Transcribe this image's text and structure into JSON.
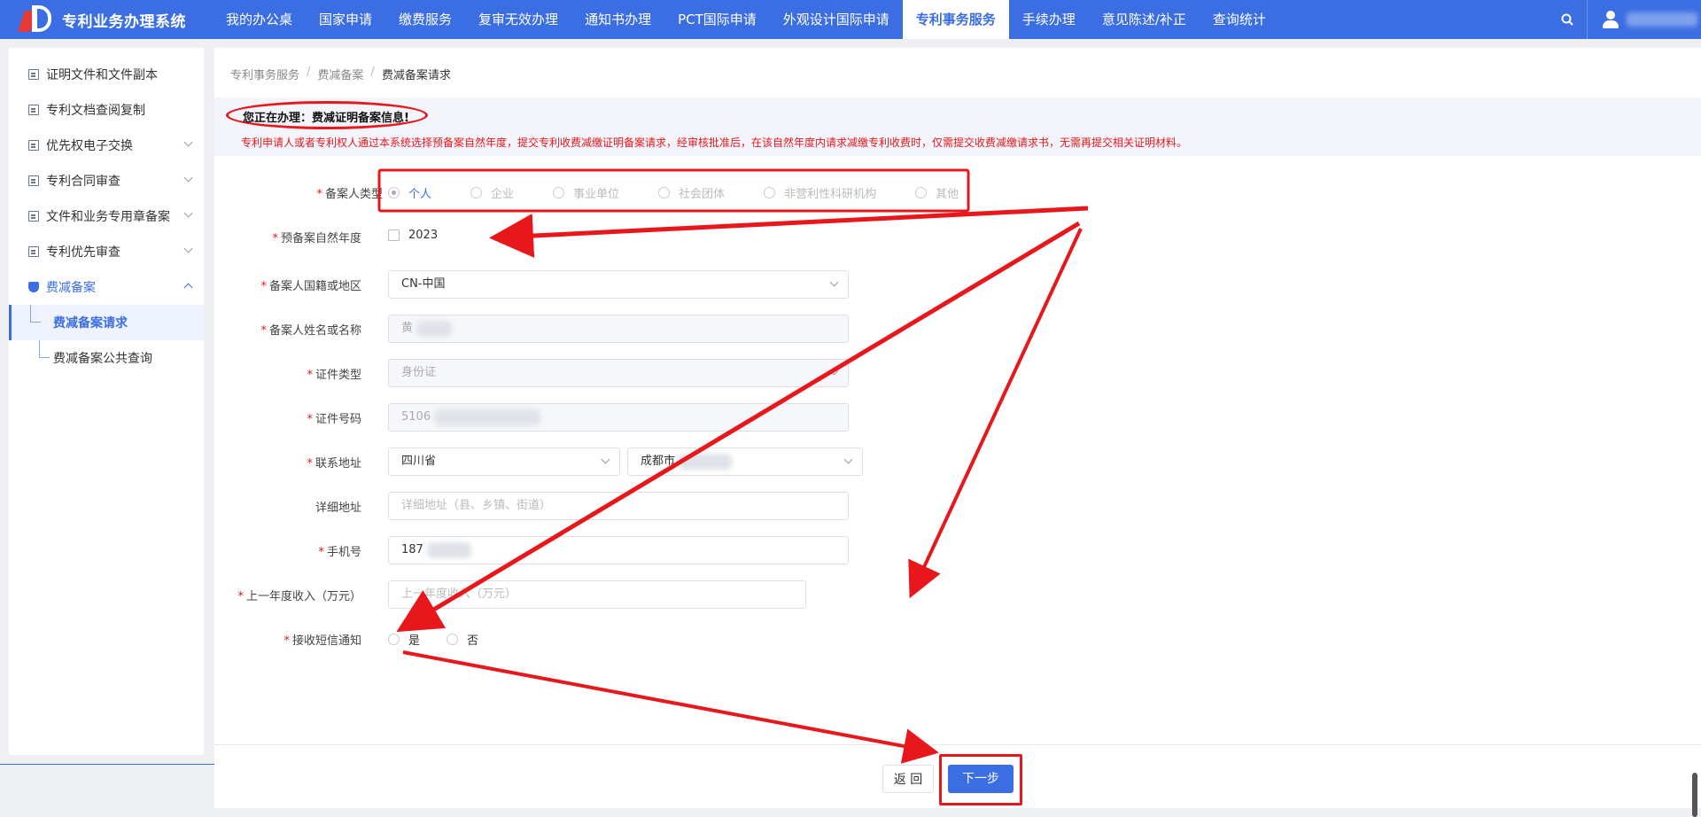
{
  "app": {
    "title": "专利业务办理系统"
  },
  "nav": {
    "items": [
      {
        "label": "我的办公桌"
      },
      {
        "label": "国家申请"
      },
      {
        "label": "缴费服务"
      },
      {
        "label": "复审无效办理"
      },
      {
        "label": "通知书办理"
      },
      {
        "label": "PCT国际申请"
      },
      {
        "label": "外观设计国际申请"
      },
      {
        "label": "专利事务服务",
        "active": true
      },
      {
        "label": "手续办理"
      },
      {
        "label": "意见陈述/补正"
      },
      {
        "label": "查询统计"
      }
    ]
  },
  "sidebar": {
    "items": [
      {
        "label": "证明文件和文件副本"
      },
      {
        "label": "专利文档查阅复制"
      },
      {
        "label": "优先权电子交换"
      },
      {
        "label": "专利合同审查"
      },
      {
        "label": "文件和业务专用章备案"
      },
      {
        "label": "专利优先审查"
      },
      {
        "label": "费减备案"
      }
    ],
    "subitems": [
      {
        "label": "费减备案请求"
      },
      {
        "label": "费减备案公共查询"
      }
    ]
  },
  "breadcrumb": {
    "l1": "专利事务服务",
    "sep": "/",
    "l2": "费减备案",
    "l3": "费减备案请求"
  },
  "notice": {
    "title": "您正在办理：费减证明备案信息!",
    "desc": "专利申请人或者专利权人通过本系统选择预备案自然年度，提交专利收费减缴证明备案请求，经审核批准后，在该自然年度内请求减缴专利收费时，仅需提交收费减缴请求书，无需再提交相关证明材料。"
  },
  "form": {
    "filer_type": {
      "label": "备案人类型",
      "options": [
        "个人",
        "企业",
        "事业单位",
        "社会团体",
        "非营利性科研机构",
        "其他"
      ],
      "selected": "个人"
    },
    "year": {
      "label": "预备案自然年度",
      "option": "2023"
    },
    "nationality": {
      "label": "备案人国籍或地区",
      "value": "CN-中国"
    },
    "name": {
      "label": "备案人姓名或名称",
      "value": "黄"
    },
    "id_type": {
      "label": "证件类型",
      "value": "身份证"
    },
    "id_number": {
      "label": "证件号码",
      "value": "5106"
    },
    "address": {
      "label": "联系地址",
      "province": "四川省",
      "city": "成都市"
    },
    "detail_address": {
      "label": "详细地址",
      "placeholder": "详细地址（县、乡镇、街道）"
    },
    "phone": {
      "label": "手机号",
      "value": "187"
    },
    "income": {
      "label": "上一年度收入（万元）",
      "placeholder": "上一年度收入（万元）"
    },
    "sms": {
      "label": "接收短信通知",
      "yes": "是",
      "no": "否"
    }
  },
  "buttons": {
    "back": "返 回",
    "next": "下一步"
  },
  "colors": {
    "primary": "#3b6ee3",
    "annotation": "#e8171c",
    "required": "#e8171c"
  }
}
